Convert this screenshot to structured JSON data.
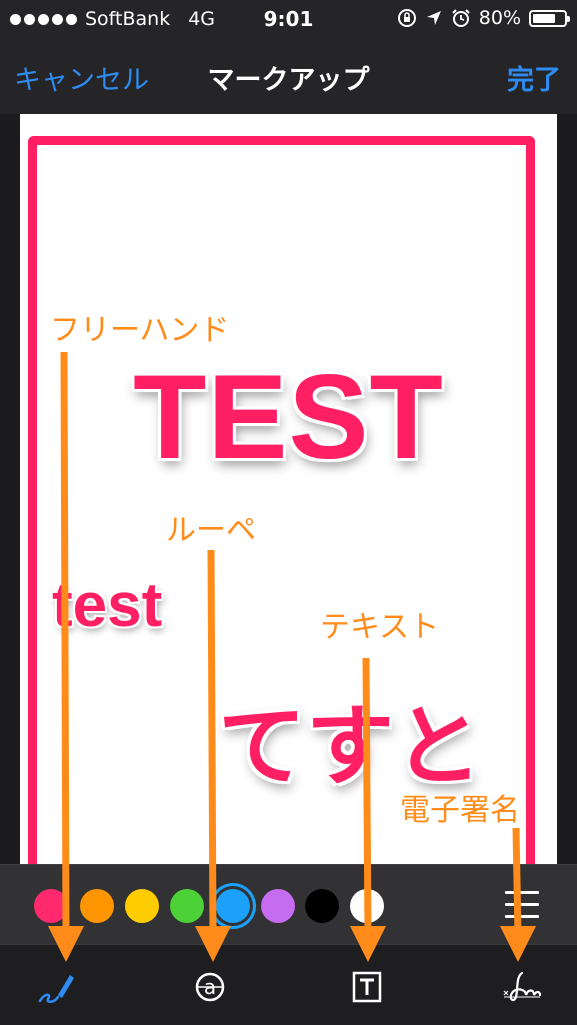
{
  "status_bar": {
    "carrier": "SoftBank",
    "network": "4G",
    "time": "9:01",
    "battery": "80%",
    "battery_level": 0.8
  },
  "nav": {
    "cancel_label": "キャンセル",
    "title": "マークアップ",
    "done_label": "完了"
  },
  "canvas": {
    "texts": [
      "TEST",
      "test",
      "てすと"
    ]
  },
  "annotations": {
    "freehand": "フリーハンド",
    "loupe": "ルーペ",
    "text": "テキスト",
    "signature": "電子署名"
  },
  "colors": {
    "accent": "#2e8cf0",
    "markup_pink": "#ff1f62",
    "annotation_orange": "#ff8c1a",
    "palette": [
      "#ff2a6d",
      "#ff9500",
      "#ffcc00",
      "#4cd137",
      "#1ba1f8",
      "#c56cf0",
      "#000000",
      "#ffffff"
    ],
    "selected_index": 4
  },
  "tools": {
    "active": "freehand",
    "icons": [
      "pen-icon",
      "loupe-icon",
      "text-box-icon",
      "signature-icon"
    ]
  }
}
